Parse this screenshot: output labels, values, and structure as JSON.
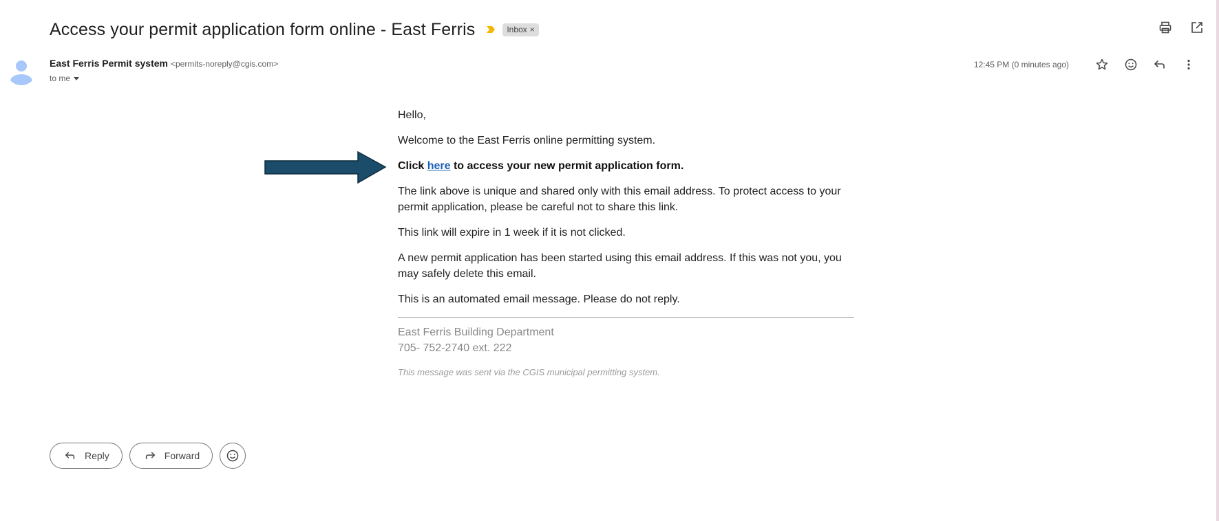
{
  "message": {
    "subject": "Access your permit application form online - East Ferris",
    "label": "Inbox",
    "label_remove": "×",
    "sender_name": "East Ferris Permit system",
    "sender_email": "<permits-noreply@cgis.com>",
    "recipient": "to me",
    "timestamp": "12:45 PM (0 minutes ago)"
  },
  "body": {
    "greeting": "Hello,",
    "welcome": "Welcome to the East Ferris online permitting system.",
    "cta_prefix": "Click",
    "cta_link": "here",
    "cta_suffix": "to access your new permit application form.",
    "unique_link_notice": "The link above is unique and shared only with this email address. To protect access to your permit application, please be careful not to share this link.",
    "expiry_notice": "This link will expire in 1 week if it is not clicked.",
    "started_notice": "A new permit application has been started using this email address. If this was not you, you may safely delete this email.",
    "automated_notice": "This is an automated email message. Please do not reply.",
    "signature_dept": "East Ferris Building Department",
    "signature_phone": "705- 752-2740 ext. 222",
    "footnote": "This message was sent via the CGIS municipal permitting system."
  },
  "actions": {
    "reply_label": "Reply",
    "forward_label": "Forward"
  },
  "icons": {
    "importance": "importance-marker-icon",
    "print": "print-icon",
    "open_new_window": "open-in-new-window-icon",
    "star": "star-icon",
    "emoji": "emoji-react-icon",
    "reply": "reply-icon",
    "more": "more-vertical-icon",
    "forward": "forward-icon",
    "avatar": "default-avatar-icon",
    "annotation_arrow": "annotation-arrow"
  },
  "colors": {
    "link": "#1a5fb4",
    "arrow_fill": "#1b4d6b",
    "importance": "#f2b705",
    "avatar": "#a8c7fa"
  }
}
